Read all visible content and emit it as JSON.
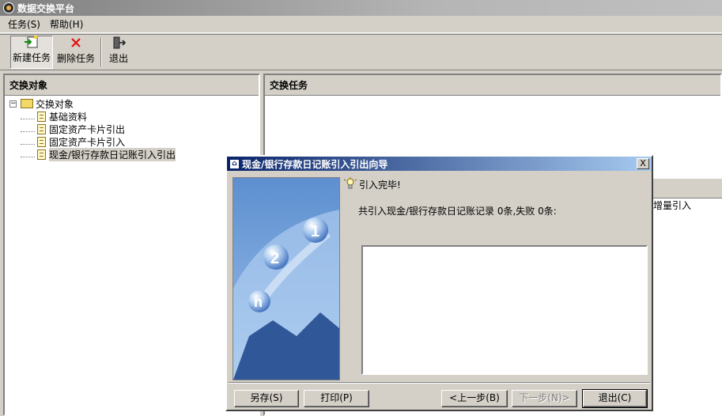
{
  "window": {
    "title": "数据交换平台"
  },
  "menu": [
    {
      "label": "任务(S)"
    },
    {
      "label": "帮助(H)"
    }
  ],
  "toolbar": {
    "new_task": "新建任务",
    "delete_task": "删除任务",
    "exit": "退出"
  },
  "left_panel": {
    "header": "交换对象",
    "tree": {
      "root": "交换对象",
      "children": [
        {
          "label": "基础资料"
        },
        {
          "label": "固定资产卡片引出"
        },
        {
          "label": "固定资产卡片引入"
        },
        {
          "label": "现金/银行存款日记账引入引出",
          "selected": true
        }
      ]
    }
  },
  "right_panel": {
    "header": "交换任务",
    "row_text": "增量引入"
  },
  "dialog": {
    "title": "现金/银行存款日记账引入引出向导",
    "close_label": "X",
    "status": "引入完毕!",
    "summary": "共引入现金/银行存款日记账记录 0条,失败 0条:",
    "buttons": {
      "save": "另存(S)",
      "print": "打印(P)",
      "back": "<上一步(B)",
      "next": "下一步(N)>",
      "exit": "退出(C)"
    }
  },
  "icons": {
    "app": "app-icon",
    "new": "new-task-icon",
    "delete": "delete-x-icon",
    "exit": "exit-door-icon",
    "bulb": "lightbulb-icon"
  },
  "colors": {
    "title_active": "#0a246a",
    "title_inactive": "#808080",
    "delete_red": "#e01010"
  }
}
